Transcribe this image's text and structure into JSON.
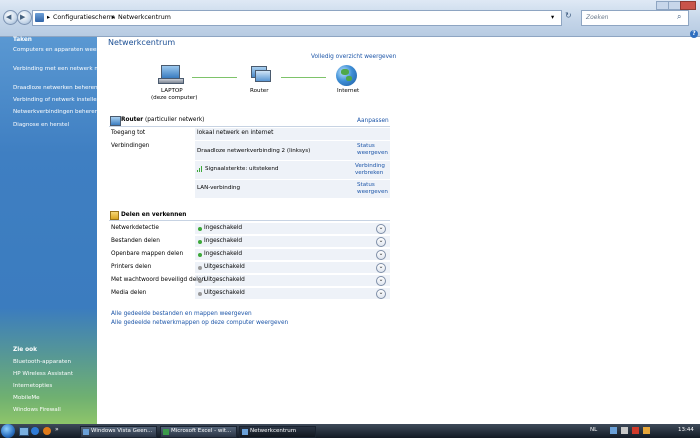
{
  "window": {
    "breadcrumb": [
      "Configuratiescherm",
      "Netwerkcentrum"
    ],
    "search_placeholder": "Zoeken"
  },
  "sidebar": {
    "tasks_title": "Taken",
    "tasks": [
      "Computers en apparaten weergeven",
      "Verbinding met een netwerk maken",
      "Draadloze netwerken beheren",
      "Verbinding of netwerk instellen",
      "Netwerkverbindingen beheren",
      "Diagnose en herstel"
    ],
    "see_also_title": "Zie ook",
    "see_also": [
      "Bluetooth-apparaten",
      "HP Wireless Assistant",
      "Internetopties",
      "MobileMe",
      "Windows Firewall"
    ]
  },
  "main": {
    "title": "Netwerkcentrum",
    "full_map_link": "Volledig overzicht weergeven",
    "map": {
      "laptop_label": "LAPTOP",
      "laptop_sublabel": "(deze computer)",
      "router_label": "Router",
      "internet_label": "Internet"
    },
    "network": {
      "name": "Router",
      "type": "(particulier netwerk)",
      "customize": "Aanpassen",
      "access_label": "Toegang tot",
      "access_value": "lokaal netwerk en internet",
      "connections_label": "Verbindingen",
      "connections": [
        {
          "name": "Draadloze netwerkverbinding 2 (linksys)",
          "action_line1": "Status",
          "action_line2": "weergeven"
        },
        {
          "name": "Signaalsterkte: uitstekend",
          "action_line1": "Verbinding",
          "action_line2": "verbreken"
        },
        {
          "name": "LAN-verbinding",
          "action_line1": "Status",
          "action_line2": "weergeven"
        }
      ]
    },
    "sharing": {
      "title": "Delen en verkennen",
      "rows": [
        {
          "label": "Netwerkdetectie",
          "value": "Ingeschakeld",
          "status_color": "#3da83a"
        },
        {
          "label": "Bestanden delen",
          "value": "Ingeschakeld",
          "status_color": "#3da83a"
        },
        {
          "label": "Openbare mappen delen",
          "value": "Ingeschakeld",
          "status_color": "#3da83a"
        },
        {
          "label": "Printers delen",
          "value": "Uitgeschakeld",
          "status_color": "#9a9a9a"
        },
        {
          "label": "Met wachtwoord beveiligd delen",
          "value": "Uitgeschakeld",
          "status_color": "#9a9a9a"
        },
        {
          "label": "Media delen",
          "value": "Uitgeschakeld",
          "status_color": "#9a9a9a"
        }
      ],
      "link1": "Alle gedeelde bestanden en mappen weergeven",
      "link2": "Alle gedeelde netwerkmappen op deze computer weergeven"
    }
  },
  "taskbar": {
    "tasks": [
      "Windows Vista Geen...",
      "Microsoft Excel - wit...",
      "Netwerkcentrum"
    ],
    "lang": "NL",
    "time": "13:44"
  }
}
